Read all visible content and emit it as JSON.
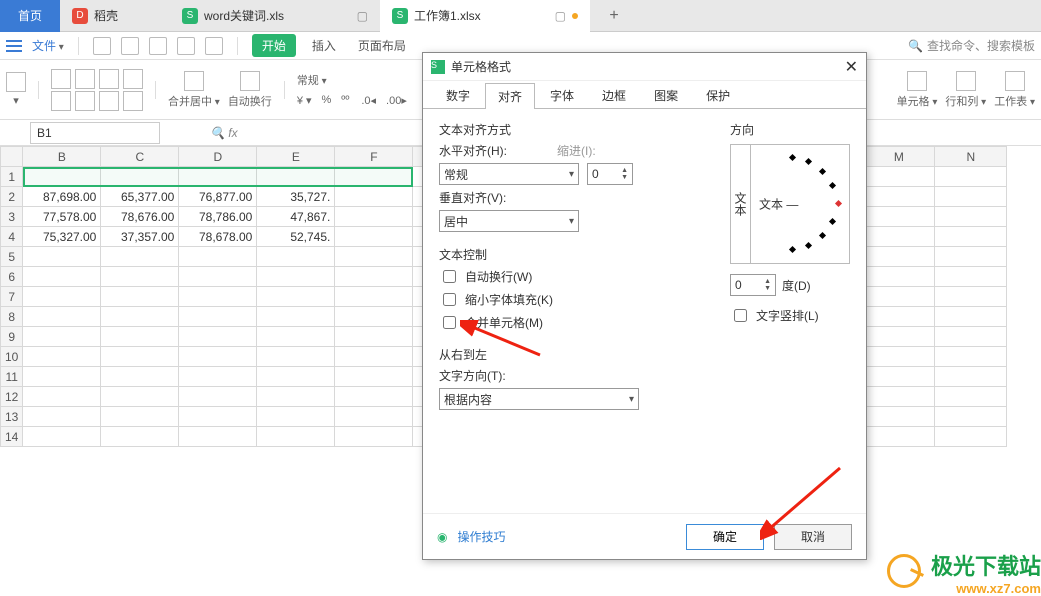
{
  "tabs": {
    "home": "首页",
    "doc1": "稻壳",
    "doc2": "word关键词.xls",
    "doc3": "工作簿1.xlsx",
    "plus": "+"
  },
  "menubar": {
    "file": "文件",
    "start": "开始",
    "insert": "插入",
    "layout": "页面布局",
    "search_placeholder": "查找命令、搜索模板"
  },
  "ribbon": {
    "merge": "合并居中",
    "wrap": "自动换行",
    "general": "常规",
    "cell": "单元格",
    "rowcol": "行和列",
    "sheet": "工作表"
  },
  "formula": {
    "cell_ref": "B1",
    "fx": "fx"
  },
  "columns": [
    "B",
    "C",
    "D",
    "E",
    "F",
    "M",
    "N"
  ],
  "rows": [
    "1",
    "2",
    "3",
    "4",
    "5",
    "6",
    "7",
    "8",
    "9",
    "10",
    "11",
    "12",
    "13",
    "14"
  ],
  "data": {
    "r2": [
      "87,698.00",
      "65,377.00",
      "76,877.00",
      "35,727."
    ],
    "r3": [
      "77,578.00",
      "78,676.00",
      "78,786.00",
      "47,867."
    ],
    "r4": [
      "75,327.00",
      "37,357.00",
      "78,678.00",
      "52,745."
    ]
  },
  "dialog": {
    "title": "单元格格式",
    "tabs": [
      "数字",
      "对齐",
      "字体",
      "边框",
      "图案",
      "保护"
    ],
    "align_group": "文本对齐方式",
    "h_align_label": "水平对齐(H):",
    "h_align_value": "常规",
    "indent_label": "缩进(I):",
    "indent_value": "0",
    "v_align_label": "垂直对齐(V):",
    "v_align_value": "居中",
    "ctrl_group": "文本控制",
    "wrap": "自动换行(W)",
    "shrink": "缩小字体填充(K)",
    "merge": "合并单元格(M)",
    "rtl_group": "从右到左",
    "textdir_label": "文字方向(T):",
    "textdir_value": "根据内容",
    "dir_group": "方向",
    "orient_vert": "文本",
    "orient_center": "文本",
    "deg_value": "0",
    "deg_label": "度(D)",
    "vstack": "文字竖排(L)",
    "tips": "操作技巧",
    "ok": "确定",
    "cancel": "取消"
  },
  "watermark": {
    "cn": "极光下载站",
    "en": "www.xz7.com"
  }
}
